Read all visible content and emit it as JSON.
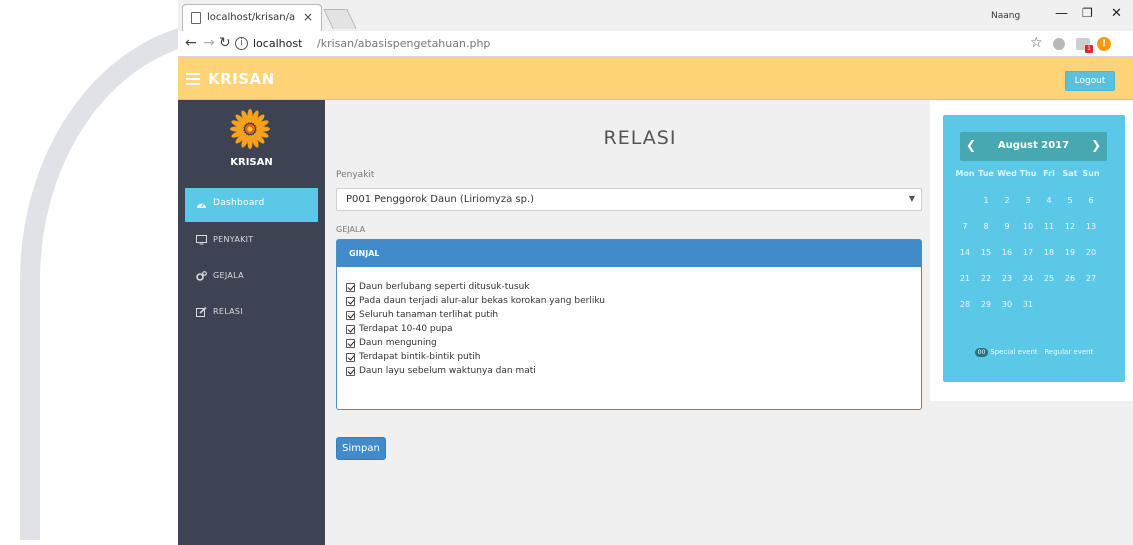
{
  "browser": {
    "tab_title": "localhost/krisan/abasisp",
    "tab_close": "×",
    "user_badge": "Naang",
    "url_host": "localhost",
    "url_path": "/krisan/abasispengetahuan.php"
  },
  "navbar": {
    "brand": "KRISAN",
    "logout_label": "Logout"
  },
  "sidebar": {
    "title": "KRISAN",
    "items": [
      {
        "label": "Dashboard",
        "icon": "dashboard-icon",
        "active": true
      },
      {
        "label": "PENYAKIT",
        "icon": "monitor-icon",
        "active": false
      },
      {
        "label": "GEJALA",
        "icon": "gears-icon",
        "active": false
      },
      {
        "label": "RELASI",
        "icon": "edit-icon",
        "active": false
      }
    ]
  },
  "main": {
    "title": "RELASI",
    "penyakit_label": "Penyakit",
    "penyakit_selected": "P001 Penggorok Daun (Liriomyza sp.)",
    "gejala_label": "GEJALA",
    "panel_title": "GINJAL",
    "gejala": [
      "Daun berlubang seperti ditusuk-tusuk",
      "Pada daun terjadi alur-alur bekas korokan yang berliku",
      "Seluruh tanaman terlihat putih",
      "Terdapat 10-40 pupa",
      "Daun menguning",
      "Terdapat bintik-bintik putih",
      "Daun layu sebelum waktunya dan mati"
    ],
    "save_label": "Simpan"
  },
  "calendar": {
    "month": "August 2017",
    "day_names": [
      "Mon",
      "Tue",
      "Wed",
      "Thu",
      "Fri",
      "Sat",
      "Sun"
    ],
    "weeks": [
      [
        "",
        "1",
        "2",
        "3",
        "4",
        "5",
        "6"
      ],
      [
        "7",
        "8",
        "9",
        "10",
        "11",
        "12",
        "13"
      ],
      [
        "14",
        "15",
        "16",
        "17",
        "18",
        "19",
        "20"
      ],
      [
        "21",
        "22",
        "23",
        "24",
        "25",
        "26",
        "27"
      ],
      [
        "28",
        "29",
        "30",
        "31",
        "",
        "",
        ""
      ]
    ],
    "legend_pill": "00",
    "legend_special": "Special event",
    "legend_regular": "Regular event"
  },
  "colors": {
    "navbar": "#ffd479",
    "sidebar": "#3d4352",
    "accent": "#5bc8e8",
    "primary": "#428bca"
  }
}
